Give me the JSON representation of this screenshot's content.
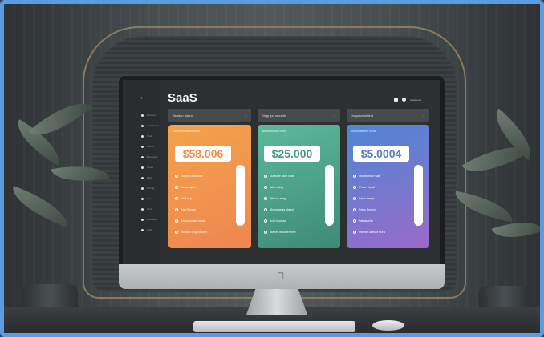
{
  "app": {
    "title": "SaaS"
  },
  "header": {
    "user_label": "Username"
  },
  "sidebar": {
    "items": [
      {
        "label": "Account"
      },
      {
        "label": "Dashboard"
      },
      {
        "label": "Tools"
      },
      {
        "label": "Teams"
      },
      {
        "label": "Messages"
      },
      {
        "label": "Notes"
      },
      {
        "label": "Labs"
      },
      {
        "label": "Pricing"
      },
      {
        "label": "Users"
      },
      {
        "label": "Tools"
      },
      {
        "label": "Followers"
      },
      {
        "label": "Links"
      }
    ]
  },
  "plans": [
    {
      "header": "Bsmtan sisilut",
      "subtitle": "Ausmumhelbumatum",
      "price": "$58.006",
      "features": [
        "Ne tem ener sbie",
        "Meismajsel",
        "Wei kiup",
        "Nes Benpul",
        "Nwhasuhaze imutie",
        "Wassid binghrbanrer"
      ],
      "gradient": [
        "#f4a24a",
        "#ee8650"
      ],
      "accent": "#ee8e48"
    },
    {
      "header": "Disgr ipo moubte",
      "subtitle": "Beuuhenbuiei elsm",
      "price": "$25.000",
      "features": [
        "Saeusfe oicer Itban",
        "Men bsisg",
        "Weuus awigi",
        "Bensegrsss sheeri",
        "Ictio fouesse",
        "Benen beucuenerbe"
      ],
      "gradient": [
        "#5cb99a",
        "#3e8a78"
      ],
      "accent": "#3f9a86"
    },
    {
      "header": "Dnsprse sisliest",
      "subtitle": "Aunsulblumm seuai",
      "price": "$5.0004",
      "features": [
        "Ielsea ineur sule",
        "Power Isbali",
        "Nshn desrpi",
        "Nses Benpsi",
        "Mesiaurisk",
        "Whean Aoeurit Hursi"
      ],
      "gradient": [
        "#4e86d4",
        "#9a6ac8"
      ],
      "accent": "#5b7ac8"
    }
  ]
}
